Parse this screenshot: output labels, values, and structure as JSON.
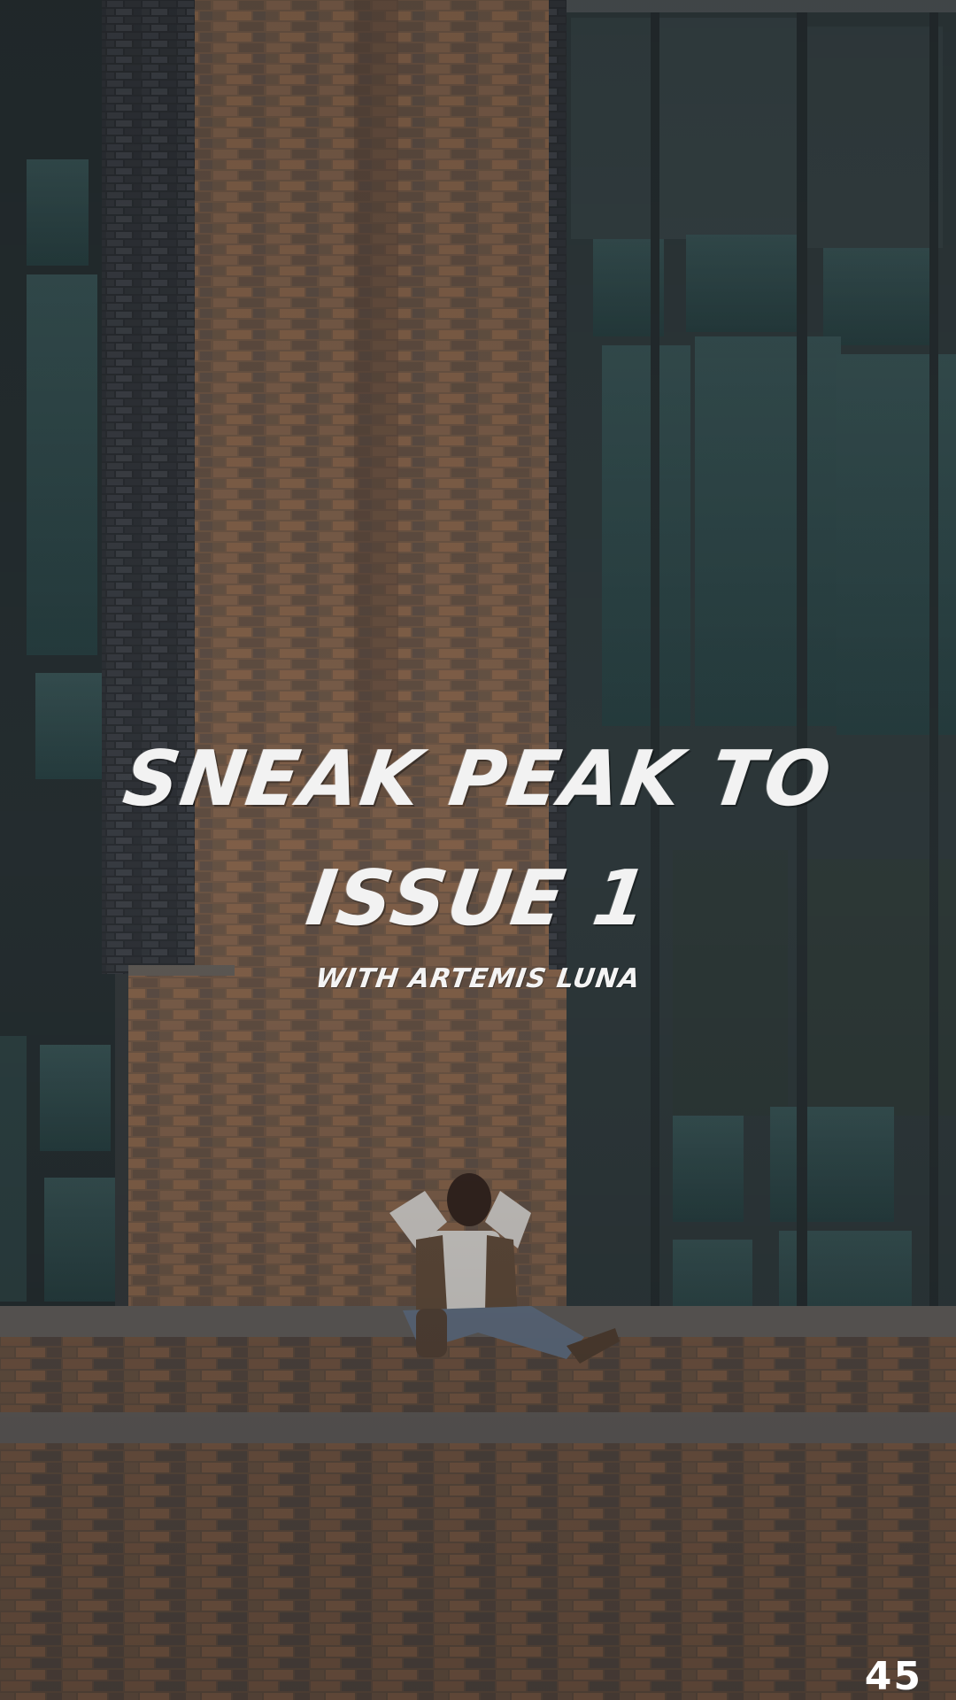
{
  "title": {
    "line1": "SNEAK PEAK TO",
    "line2": "ISSUE 1"
  },
  "subtitle": "WITH ARTEMIS LUNA",
  "page_number": "45",
  "colors": {
    "text": "#f2f2f2",
    "brick": "#8a6a55",
    "dark_brick": "#3b3f45",
    "glass": "#2f4b4d",
    "frame": "#3c4448"
  }
}
